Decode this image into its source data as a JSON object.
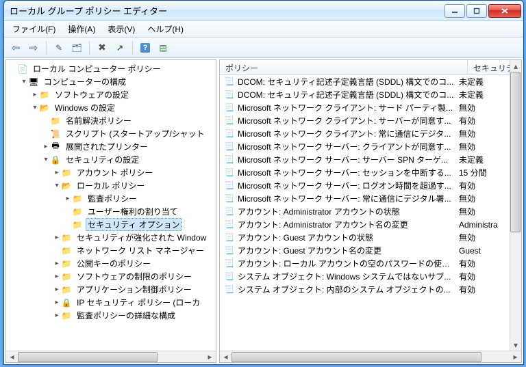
{
  "window": {
    "title": "ローカル グループ ポリシー エディター"
  },
  "menubar": {
    "items": [
      "ファイル(F)",
      "操作(A)",
      "表示(V)",
      "ヘルプ(H)"
    ]
  },
  "tree": {
    "nodes": [
      {
        "depth": 0,
        "exp": "",
        "icon": "i-root",
        "label": "ローカル コンピューター ポリシー"
      },
      {
        "depth": 1,
        "exp": "▾",
        "icon": "i-comp",
        "label": "コンピューターの構成"
      },
      {
        "depth": 2,
        "exp": "▸",
        "icon": "i-folder",
        "label": "ソフトウェアの設定"
      },
      {
        "depth": 2,
        "exp": "▾",
        "icon": "i-folder-open",
        "label": "Windows の設定"
      },
      {
        "depth": 3,
        "exp": "",
        "icon": "i-folder",
        "label": "名前解決ポリシー"
      },
      {
        "depth": 3,
        "exp": "",
        "icon": "i-script",
        "label": "スクリプト (スタートアップ/シャット"
      },
      {
        "depth": 3,
        "exp": "▸",
        "icon": "i-printer",
        "label": "展開されたプリンター"
      },
      {
        "depth": 3,
        "exp": "▾",
        "icon": "i-lock",
        "label": "セキュリティの設定"
      },
      {
        "depth": 4,
        "exp": "▸",
        "icon": "i-folder",
        "label": "アカウント ポリシー"
      },
      {
        "depth": 4,
        "exp": "▾",
        "icon": "i-folder-open",
        "label": "ローカル ポリシー"
      },
      {
        "depth": 5,
        "exp": "▸",
        "icon": "i-folder",
        "label": "監査ポリシー"
      },
      {
        "depth": 5,
        "exp": "",
        "icon": "i-folder",
        "label": "ユーザー権利の割り当て"
      },
      {
        "depth": 5,
        "exp": "",
        "icon": "i-folder",
        "label": "セキュリティ オプション",
        "selected": true
      },
      {
        "depth": 4,
        "exp": "▸",
        "icon": "i-folder",
        "label": "セキュリティが強化された Window"
      },
      {
        "depth": 4,
        "exp": "",
        "icon": "i-folder",
        "label": "ネットワーク リスト マネージャー"
      },
      {
        "depth": 4,
        "exp": "▸",
        "icon": "i-folder",
        "label": "公開キーのポリシー"
      },
      {
        "depth": 4,
        "exp": "▸",
        "icon": "i-folder",
        "label": "ソフトウェアの制限のポリシー"
      },
      {
        "depth": 4,
        "exp": "▸",
        "icon": "i-folder",
        "label": "アプリケーション制御ポリシー"
      },
      {
        "depth": 4,
        "exp": "▸",
        "icon": "i-lock",
        "label": "IP セキュリティ ポリシー (ローカ"
      },
      {
        "depth": 4,
        "exp": "▸",
        "icon": "i-folder",
        "label": "監査ポリシーの詳細な構成"
      }
    ]
  },
  "list": {
    "columns": {
      "policy": "ポリシー",
      "setting": "セキュリティ"
    },
    "rows": [
      {
        "p": "DCOM: セキュリティ記述子定義言語 (SDDL) 構文でのコ...",
        "s": "未定義"
      },
      {
        "p": "DCOM: セキュリティ記述子定義言語 (SDDL) 構文でのコ...",
        "s": "未定義"
      },
      {
        "p": "Microsoft ネットワーク クライアント: サード パーティ製...",
        "s": "無効"
      },
      {
        "p": "Microsoft ネットワーク クライアント: サーバーが同意す...",
        "s": "有効"
      },
      {
        "p": "Microsoft ネットワーク クライアント: 常に通信にデジタ...",
        "s": "無効"
      },
      {
        "p": "Microsoft ネットワーク サーバー: クライアントが同意す...",
        "s": "無効"
      },
      {
        "p": "Microsoft ネットワーク サーバー: サーバー SPN ターゲ...",
        "s": "未定義"
      },
      {
        "p": "Microsoft ネットワーク サーバー: セッションを中断する...",
        "s": "15 分間"
      },
      {
        "p": "Microsoft ネットワーク サーバー: ログオン時間を超過す...",
        "s": "有効"
      },
      {
        "p": "Microsoft ネットワーク サーバー: 常に通信にデジタル署...",
        "s": "無効"
      },
      {
        "p": "アカウント: Administrator アカウントの状態",
        "s": "無効"
      },
      {
        "p": "アカウント: Administrator アカウント名の変更",
        "s": "Administra"
      },
      {
        "p": "アカウント: Guest アカウントの状態",
        "s": "無効"
      },
      {
        "p": "アカウント: Guest アカウント名の変更",
        "s": "Guest"
      },
      {
        "p": "アカウント: ローカル アカウントの空のパスワードの使用...",
        "s": "有効"
      },
      {
        "p": "システム オブジェクト: Windows システムではないサブ...",
        "s": "有効"
      },
      {
        "p": "システム オブジェクト: 内部のシステム オブジェクトの...",
        "s": "有効"
      }
    ]
  }
}
